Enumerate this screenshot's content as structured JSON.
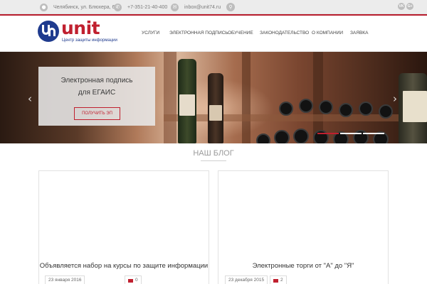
{
  "topbar": {
    "address": "Челябинск, ул. Блюхера, 69",
    "phone": "+7-351-21-40-400",
    "email": "inbox@unit74.ru",
    "icons": {
      "address": "location-icon",
      "phone": "phone-icon",
      "email": "mail-icon",
      "search": "search-icon"
    },
    "social": [
      "VK",
      "G+"
    ]
  },
  "logo": {
    "name": "unit",
    "subtitle": "Центр защиты информации"
  },
  "nav": {
    "items": [
      "Услуги",
      "Электронная подпись",
      "Обучение",
      "Законодательство",
      "О компании",
      "Заявка"
    ]
  },
  "hero": {
    "title_line1": "Электронная подпись",
    "title_line2": "для ЕГАИС",
    "button": "Получить ЭП",
    "prev_arrow": "‹",
    "next_arrow": "›",
    "slides_count": 3,
    "active_slide": 1
  },
  "blog": {
    "title": "Наш блог",
    "posts": [
      {
        "title": "Объявляется набор на курсы по защите информации",
        "date": "23 января 2016",
        "comments": "0"
      },
      {
        "title": "Электронные торги от \"А\" до \"Я\"",
        "date": "23 декабря 2015",
        "comments": "2"
      }
    ]
  },
  "colors": {
    "accent": "#c0202f",
    "brand_blue": "#1f3b8e"
  }
}
